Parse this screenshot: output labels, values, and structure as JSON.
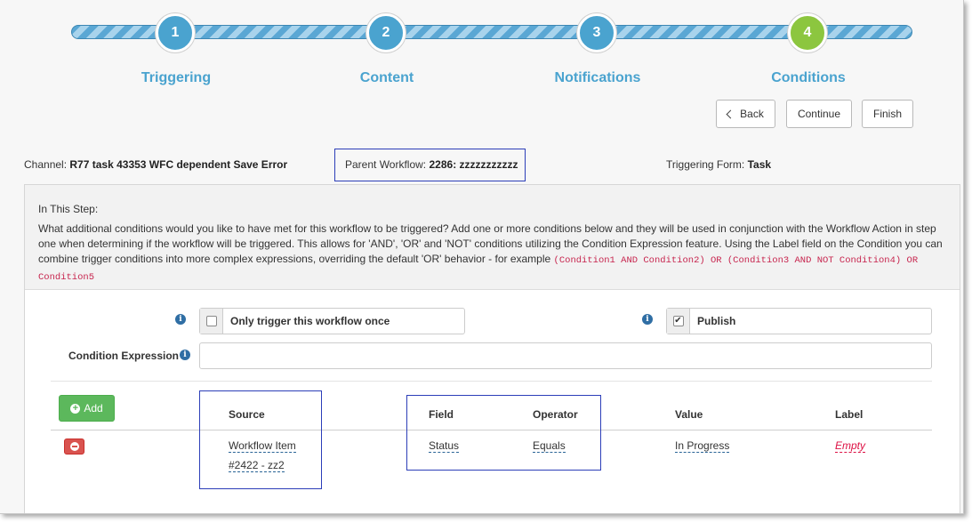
{
  "wizard": {
    "steps": [
      {
        "number": "1",
        "label": "Triggering",
        "color": "#4aa3cf"
      },
      {
        "number": "2",
        "label": "Content",
        "color": "#4aa3cf"
      },
      {
        "number": "3",
        "label": "Notifications",
        "color": "#4aa3cf"
      },
      {
        "number": "4",
        "label": "Conditions",
        "color": "#8cc63f"
      }
    ],
    "label_color": "#4aa3cf",
    "back_label": "Back",
    "continue_label": "Continue",
    "finish_label": "Finish"
  },
  "info": {
    "channel_label": "Channel:",
    "channel_value": "R77 task 43353 WFC dependent Save Error",
    "parent_label": "Parent Workflow:",
    "parent_value": "2286: zzzzzzzzzzz",
    "form_label": "Triggering Form:",
    "form_value": "Task"
  },
  "step_help": {
    "title": "In This Step:",
    "text": "What additional conditions would you like to have met for this workflow to be triggered? Add one or more conditions below and they will be used in conjunction with the Workflow Action in step one when determining if the workflow will be triggered. This allows for 'AND', 'OR' and 'NOT' conditions utilizing the Condition Expression feature. Using the Label field on the Condition you can combine trigger conditions into more complex expressions, overriding the default 'OR' behavior - for example",
    "example": "(Condition1 AND Condition2) OR (Condition3 AND NOT Condition4) OR Condition5"
  },
  "options": {
    "only_once_label": "Only trigger this workflow once",
    "only_once_checked": false,
    "publish_label": "Publish",
    "publish_checked": true,
    "check_glyph": "✔",
    "expression_label": "Condition Expression",
    "expression_value": ""
  },
  "conditions": {
    "add_label": "Add",
    "columns": {
      "source": "Source",
      "field": "Field",
      "operator": "Operator",
      "value": "Value",
      "label": "Label"
    },
    "rows": [
      {
        "source_line1": "Workflow Item",
        "source_line2": "#2422 - zz2",
        "field": "Status",
        "operator": "Equals",
        "value": "In Progress",
        "label": "Empty"
      }
    ]
  },
  "icons": {
    "info": "info-circle-icon",
    "add": "plus-circle-icon",
    "remove": "minus-circle-icon",
    "back": "chevron-left-icon"
  }
}
